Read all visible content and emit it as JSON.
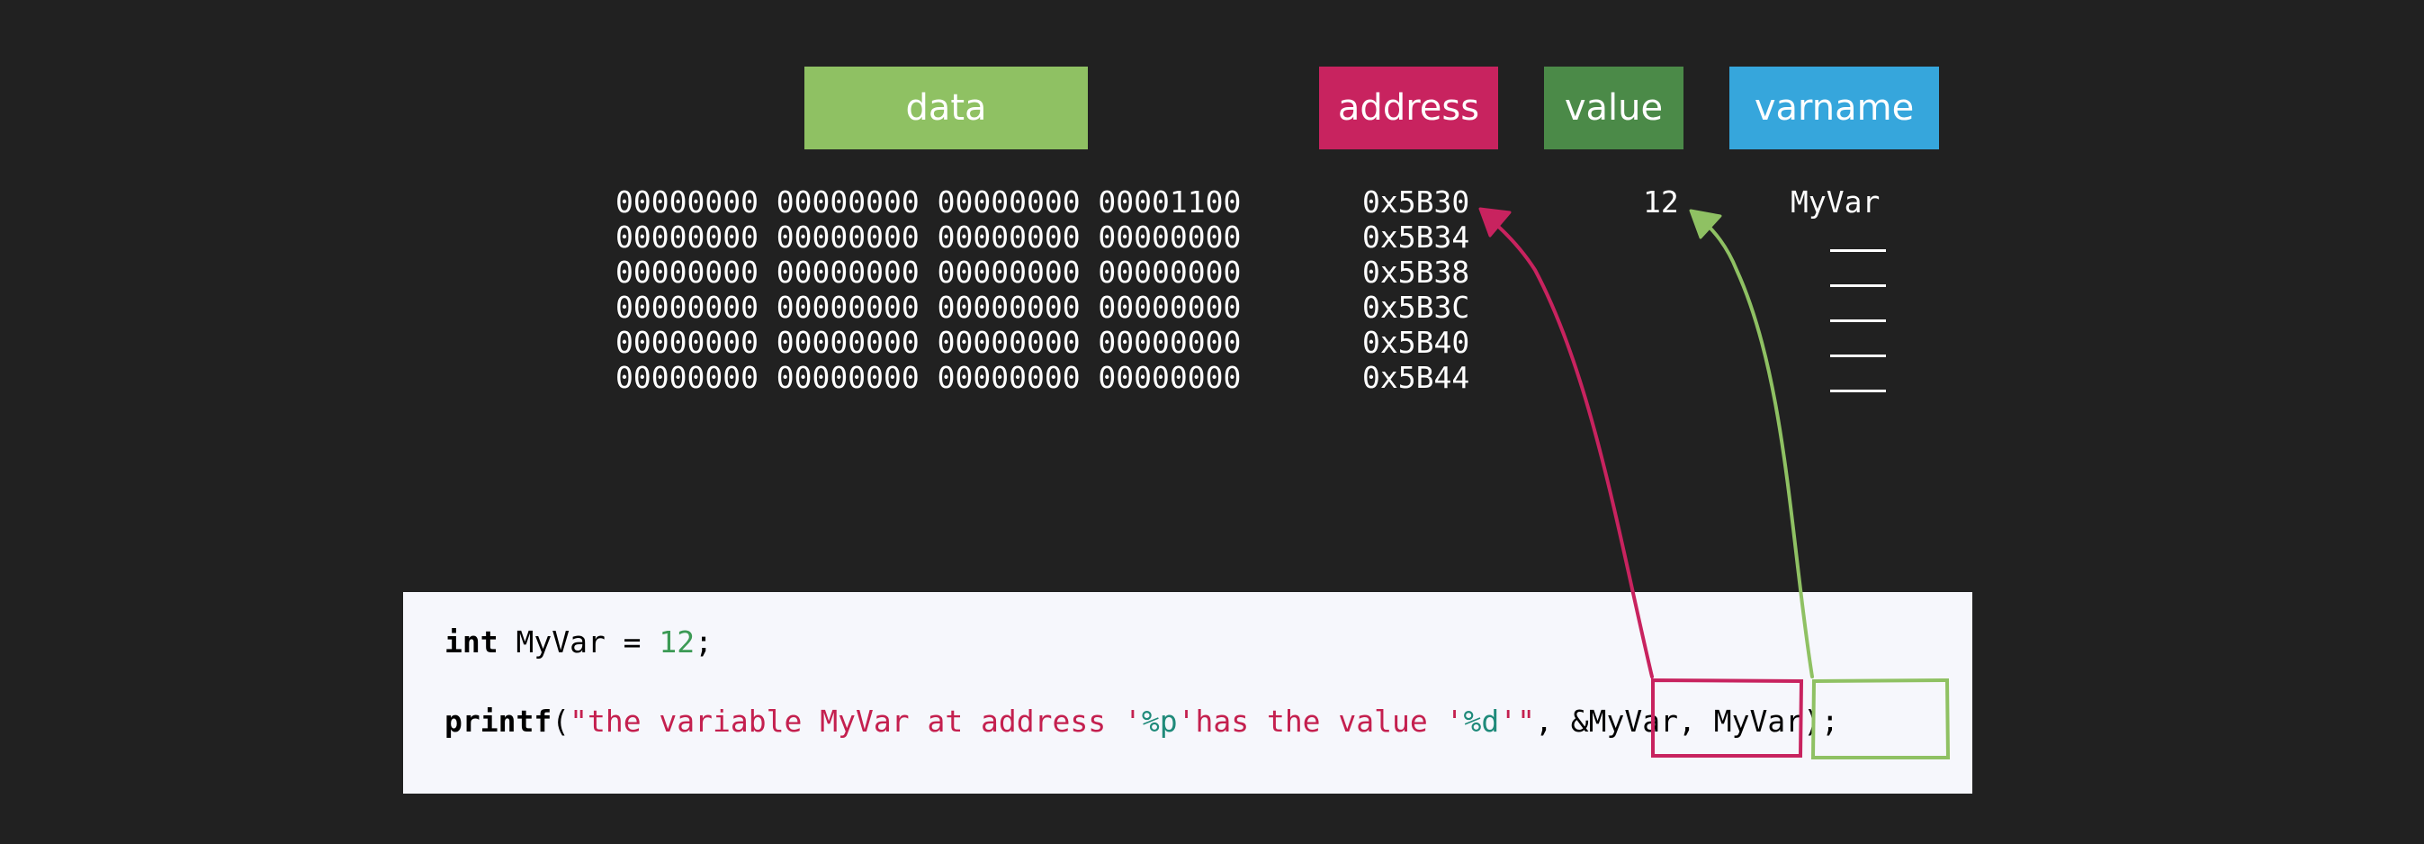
{
  "headers": {
    "data": "data",
    "address": "address",
    "value": "value",
    "varname": "varname"
  },
  "colors": {
    "data": "#8fc163",
    "address": "#c8235f",
    "value": "#4b8a48",
    "varname": "#36a6dc",
    "background": "#212121",
    "code_bg": "#f6f7fc"
  },
  "rows": [
    {
      "bytes": "00000000 00000000 00000000 00001100",
      "address": "0x5B30"
    },
    {
      "bytes": "00000000 00000000 00000000 00000000",
      "address": "0x5B34"
    },
    {
      "bytes": "00000000 00000000 00000000 00000000",
      "address": "0x5B38"
    },
    {
      "bytes": "00000000 00000000 00000000 00000000",
      "address": "0x5B3C"
    },
    {
      "bytes": "00000000 00000000 00000000 00000000",
      "address": "0x5B40"
    },
    {
      "bytes": "00000000 00000000 00000000 00000000",
      "address": "0x5B44"
    }
  ],
  "value": "12",
  "varname": "MyVar",
  "code": {
    "line1": {
      "keyword": "int",
      "rest": " MyVar = ",
      "number": "12",
      "end": ";"
    },
    "line2": {
      "keyword": "printf",
      "open": "(",
      "str1": "\"the variable MyVar at address '",
      "fmt1": "%p",
      "str2": "'has the value '",
      "fmt2": "%d",
      "str3": "'\"",
      "comma1": ", ",
      "arg1": "&MyVar",
      "comma2": ",",
      "arg2": " MyVar",
      "close": ");"
    }
  }
}
